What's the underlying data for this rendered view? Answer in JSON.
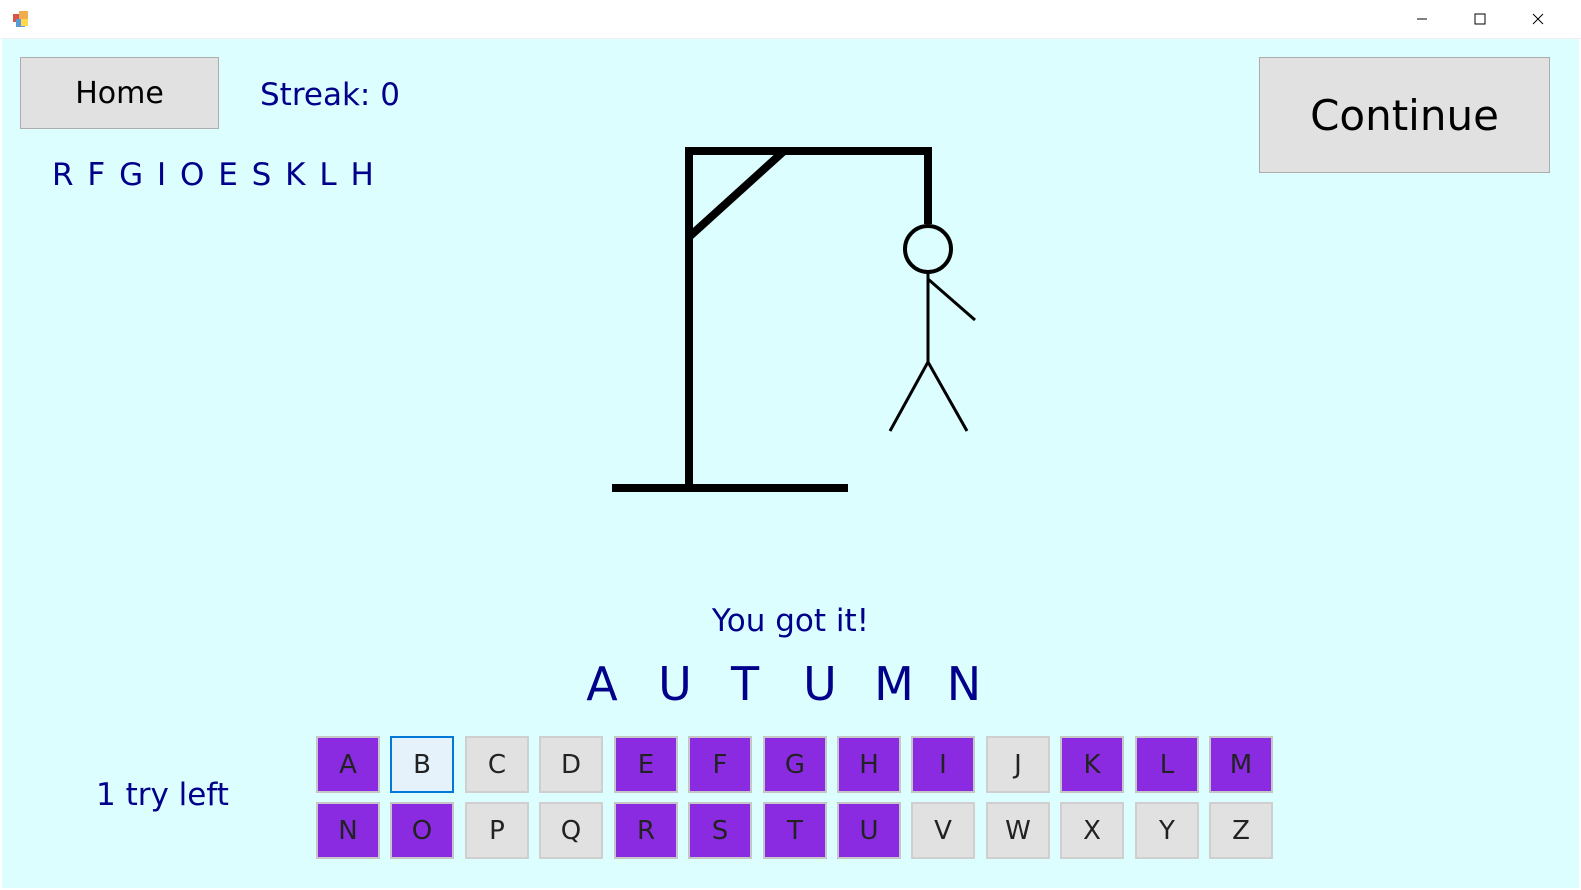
{
  "window": {
    "minimize_glyph": "─",
    "maximize_glyph": "☐",
    "close_glyph": "✕"
  },
  "home_button": {
    "label": "Home"
  },
  "continue_button": {
    "label": "Continue"
  },
  "streak": {
    "text": "Streak: 0"
  },
  "guessed_letters": {
    "text": "R F G I O E S K L H"
  },
  "message": {
    "text": "You got it!"
  },
  "word": {
    "letters": [
      "A",
      "U",
      "T",
      "U",
      "M",
      "N"
    ]
  },
  "tries": {
    "text": "1 try left"
  },
  "keyboard": {
    "row1": [
      {
        "letter": "A",
        "state": "used"
      },
      {
        "letter": "B",
        "state": "focused"
      },
      {
        "letter": "C",
        "state": "available"
      },
      {
        "letter": "D",
        "state": "available"
      },
      {
        "letter": "E",
        "state": "used"
      },
      {
        "letter": "F",
        "state": "used"
      },
      {
        "letter": "G",
        "state": "used"
      },
      {
        "letter": "H",
        "state": "used"
      },
      {
        "letter": "I",
        "state": "used"
      },
      {
        "letter": "J",
        "state": "available"
      },
      {
        "letter": "K",
        "state": "used"
      },
      {
        "letter": "L",
        "state": "used"
      },
      {
        "letter": "M",
        "state": "used"
      }
    ],
    "row2": [
      {
        "letter": "N",
        "state": "used"
      },
      {
        "letter": "O",
        "state": "used"
      },
      {
        "letter": "P",
        "state": "available"
      },
      {
        "letter": "Q",
        "state": "available"
      },
      {
        "letter": "R",
        "state": "used"
      },
      {
        "letter": "S",
        "state": "used"
      },
      {
        "letter": "T",
        "state": "used"
      },
      {
        "letter": "U",
        "state": "used"
      },
      {
        "letter": "V",
        "state": "available"
      },
      {
        "letter": "W",
        "state": "available"
      },
      {
        "letter": "X",
        "state": "available"
      },
      {
        "letter": "Y",
        "state": "available"
      },
      {
        "letter": "Z",
        "state": "available"
      }
    ]
  },
  "colors": {
    "background": "#dcfefe",
    "text": "#00008b",
    "used_key": "#8a2be2",
    "key": "#e1e1e1",
    "focus": "#0078d7"
  }
}
